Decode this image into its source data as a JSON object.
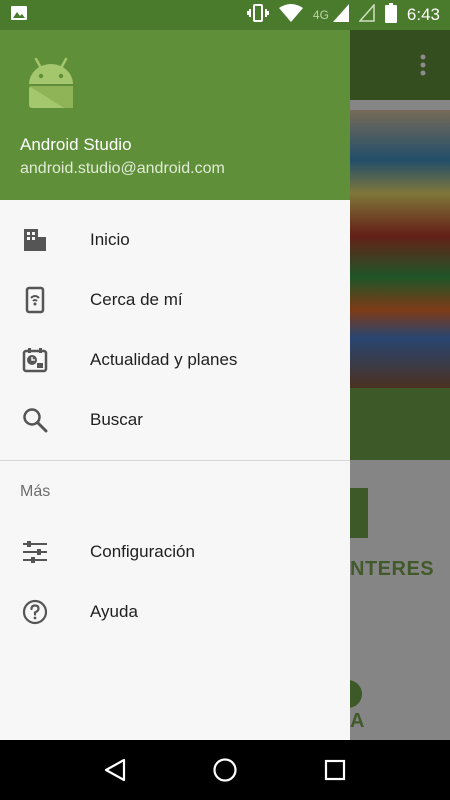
{
  "status_bar": {
    "time": "6:43",
    "network": "4G",
    "icons": [
      "image-notification-icon",
      "vibrate-icon",
      "wifi-icon",
      "signal-icon",
      "signal-empty-icon",
      "battery-icon"
    ]
  },
  "drawer": {
    "header": {
      "name": "Android Studio",
      "email": "android.studio@android.com",
      "avatar_icon": "android-logo-icon"
    },
    "items": [
      {
        "label": "Inicio",
        "icon": "home-building-icon"
      },
      {
        "label": "Cerca de mí",
        "icon": "phone-nearby-icon"
      },
      {
        "label": "Actualidad y planes",
        "icon": "calendar-clock-icon"
      },
      {
        "label": "Buscar",
        "icon": "search-icon"
      }
    ],
    "section_title": "Más",
    "more_items": [
      {
        "label": "Configuración",
        "icon": "sliders-icon"
      },
      {
        "label": "Ayuda",
        "icon": "help-icon"
      }
    ]
  },
  "background": {
    "text_1": "NTERES",
    "text_2": "A"
  },
  "nav_bar": {
    "buttons": [
      "back-icon",
      "home-icon",
      "recents-icon"
    ]
  },
  "colors": {
    "primary": "#5f8f39",
    "status": "#4a7a2b",
    "drawer_bg": "#f7f7f7"
  }
}
